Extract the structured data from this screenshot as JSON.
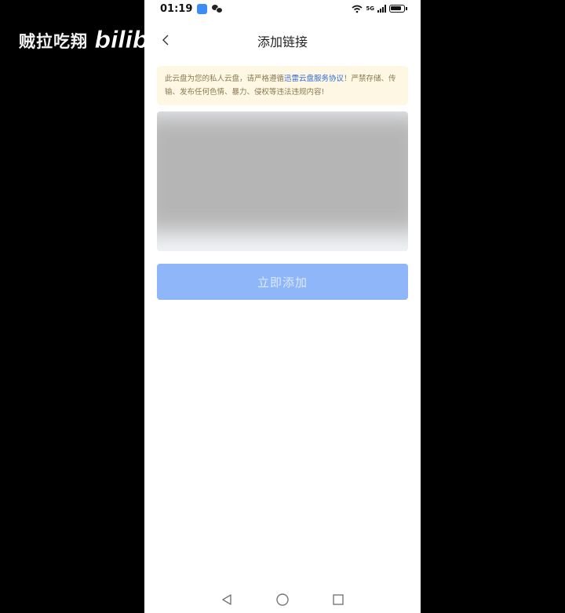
{
  "watermark": {
    "channel_name": "贼拉吃翔",
    "logo_text": "bilibili"
  },
  "status_bar": {
    "time": "01:19",
    "network": "5G"
  },
  "header": {
    "title": "添加链接",
    "back_icon": "chevron-left-icon"
  },
  "notice": {
    "text_before": "此云盘为您的私人云盘，请严格遵循",
    "link_text": "迅雷云盘服务协议",
    "text_after": "！严禁存储、传输、发布任何色情、暴力、侵权等违法违规内容!"
  },
  "link_input": {
    "value": "",
    "placeholder": ""
  },
  "actions": {
    "add_now_label": "立即添加"
  },
  "nav": {
    "back_icon": "triangle-back-icon",
    "home_icon": "circle-home-icon",
    "recents_icon": "square-recents-icon"
  },
  "colors": {
    "accent": "#2f6bd8",
    "button_disabled": "#8fb6f8",
    "notice_bg": "#fdf7e4"
  }
}
